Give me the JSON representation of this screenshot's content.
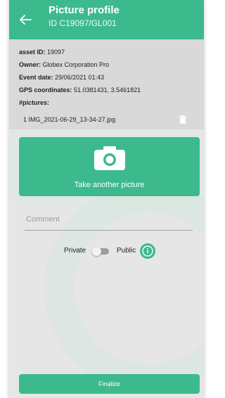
{
  "header": {
    "title": "Picture profile",
    "subtitle": "ID C19097/GL001",
    "back_icon": "arrow-left-icon"
  },
  "info": {
    "asset_id_label": "asset ID:",
    "asset_id_value": "19097",
    "owner_label": "Owner:",
    "owner_value": "Globex Corporation Pro",
    "event_date_label": "Event date:",
    "event_date_value": "29/06/2021 01:43",
    "gps_label": "GPS coordinates:",
    "gps_value": "51.0381431, 3.5461821",
    "pictures_label": "#pictures:",
    "pictures": [
      {
        "index": "1",
        "filename": "IMG_2021-06-29_13-34-27.jpg"
      }
    ]
  },
  "camera_card": {
    "label": "Take another picture",
    "icon": "camera-icon"
  },
  "comment": {
    "placeholder": "Comment",
    "value": ""
  },
  "privacy": {
    "private_label": "Private",
    "public_label": "Public",
    "selected": "Private",
    "info_icon": "info-icon"
  },
  "finalize_label": "Finalize",
  "colors": {
    "accent": "#3cba8e",
    "panel": "#d9d9d9",
    "background": "#e6e6e6"
  }
}
